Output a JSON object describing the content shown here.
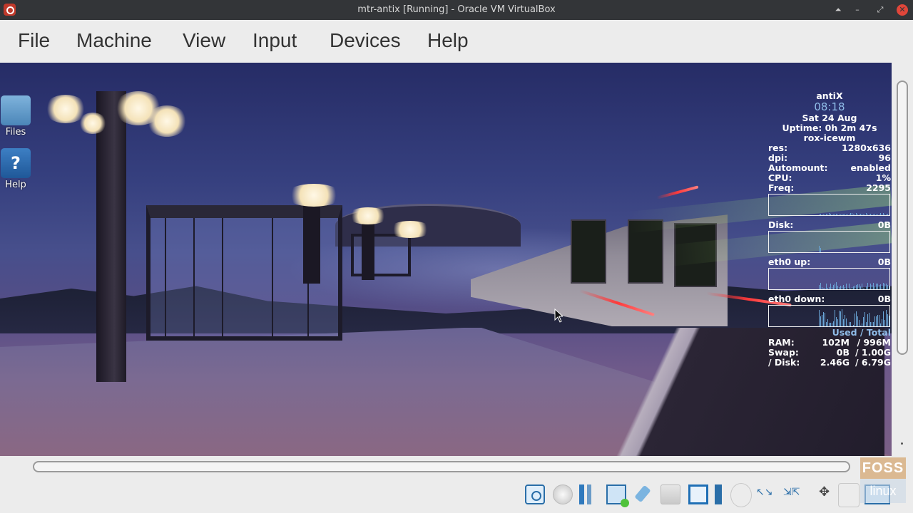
{
  "window": {
    "title": "mtr-antix [Running] - Oracle VM VirtualBox",
    "app_icon": "virtualbox-icon",
    "controls": [
      "shade-icon",
      "minimize-icon",
      "maximize-icon",
      "close-icon"
    ]
  },
  "menu": {
    "items": [
      {
        "label": "File"
      },
      {
        "label": "Machine"
      },
      {
        "label": "View"
      },
      {
        "label": "Input"
      },
      {
        "label": "Devices"
      },
      {
        "label": "Help"
      }
    ]
  },
  "desktop": {
    "icons": [
      {
        "label": "Files",
        "icon": "folder-home-icon"
      },
      {
        "label": "Help",
        "icon": "help-icon",
        "glyph": "?"
      }
    ]
  },
  "conky": {
    "host": "antiX",
    "time": "08:18",
    "date": "Sat 24 Aug",
    "uptime": "Uptime: 0h 2m 47s",
    "wm": "rox-icewm",
    "stats": [
      {
        "label": "res:",
        "value": "1280x636"
      },
      {
        "label": "dpi:",
        "value": "96"
      },
      {
        "label": "Automount:",
        "value": "enabled"
      },
      {
        "label": "CPU:",
        "value": "1%"
      },
      {
        "label": "Freq:",
        "value": "2295"
      }
    ],
    "graphs": [
      {
        "label": "Disk:",
        "value": "0B"
      },
      {
        "label": "eth0 up:",
        "value": "0B"
      },
      {
        "label": "eth0 down:",
        "value": "0B"
      }
    ],
    "memory_header": "Used / Total",
    "memory": [
      {
        "label": "RAM:",
        "used": "102M",
        "total": "/ 996M"
      },
      {
        "label": "Swap:",
        "used": "0B",
        "total": "/ 1.00G"
      },
      {
        "label": "/ Disk:",
        "used": "2.46G",
        "total": "/ 6.79G"
      }
    ]
  },
  "statusbar": {
    "icons": [
      "hard-disk-icon",
      "optical-drive-icon",
      "audio-icon",
      "network-icon",
      "usb-icon",
      "shared-folders-icon",
      "display-icon",
      "recording-icon",
      "cpu-icon",
      "mouse-integration-icon",
      "scale-icon",
      "move-icon",
      "host-key-icon",
      "mouse-capture-icon"
    ]
  },
  "watermark": {
    "line1": "FOSS",
    "line2": "linux"
  },
  "colors": {
    "titlebar": "#333538",
    "close_button": "#e0463a",
    "menubar": "#ececec",
    "conky_text": "#ffffff",
    "conky_accent": "#8fbce8"
  }
}
